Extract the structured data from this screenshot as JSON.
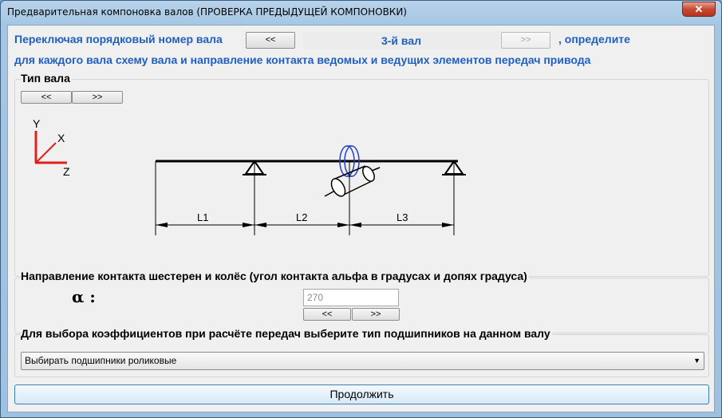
{
  "window": {
    "title": "Предварительная компоновка валов (ПРОВЕРКА ПРЕДЫДУЩЕЙ КОМПОНОВКИ)",
    "close_glyph": "✕"
  },
  "header": {
    "text_left": "Переключая порядковый номер вала",
    "prev_label": "<<",
    "shaft_label": "3-й вал",
    "next_label": ">>",
    "text_right": ", определите",
    "text_line2": "для каждого вала схему вала и направление контакта ведомых и ведущих элементов передач привода"
  },
  "shaft_type": {
    "title": "Тип вала",
    "prev_label": "<<",
    "next_label": ">>",
    "axes": {
      "y": "Y",
      "x": "X",
      "z": "Z"
    },
    "dims": [
      "L1",
      "L2",
      "L3"
    ]
  },
  "contact": {
    "title": "Направление контакта шестерен и колёс (угол контакта альфа в градусах и допях градуса)",
    "alpha_label": "α :",
    "angle_value": "270",
    "prev_label": "<<",
    "next_label": ">>"
  },
  "bearings": {
    "title": "Для выбора коэффициентов при расчёте передач выберите тип подшипников на данном валу",
    "selected": "Выбирать подшипники роликовые"
  },
  "continue_label": "Продолжить",
  "colors": {
    "accent_text": "#1f5fbf",
    "axis_red": "#e02020",
    "gear_blue": "#2040d0"
  }
}
